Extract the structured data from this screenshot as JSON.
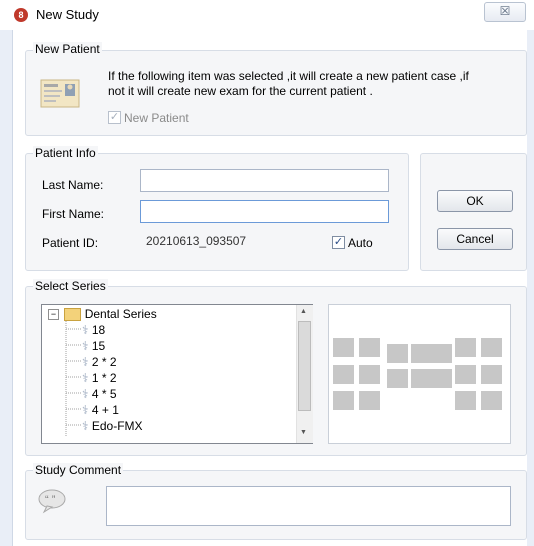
{
  "window": {
    "title": "New Study",
    "close_glyph": "☒"
  },
  "new_patient": {
    "group_label": "New Patient",
    "description_line1": "If the following item was selected ,it will create a new patient case ,if",
    "description_line2": "not it will create  new exam for the current patient .",
    "checkbox_label": "New Patient",
    "checked": true,
    "icon": "patient-card-icon"
  },
  "patient_info": {
    "group_label": "Patient Info",
    "last_name_label": "Last Name:",
    "last_name_value": "",
    "first_name_label": "First Name:",
    "first_name_value": "",
    "patient_id_label": "Patient ID:",
    "patient_id_value": "20210613_093507",
    "auto_label": "Auto",
    "auto_checked": true
  },
  "buttons": {
    "ok": "OK",
    "cancel": "Cancel"
  },
  "select_series": {
    "group_label": "Select Series",
    "root": "Dental Series",
    "items": [
      "18",
      "15",
      "2 * 2",
      "1 * 2",
      "4 * 5",
      "4 + 1",
      "Edo-FMX"
    ]
  },
  "study_comment": {
    "group_label": "Study Comment",
    "value": "",
    "icon": "speech-bubble-icon"
  },
  "colors": {
    "window_bg": "#e9eef7",
    "group_bg": "#f5f6f8",
    "tile": "#c7c7c7",
    "app_icon": "#c0392b"
  }
}
